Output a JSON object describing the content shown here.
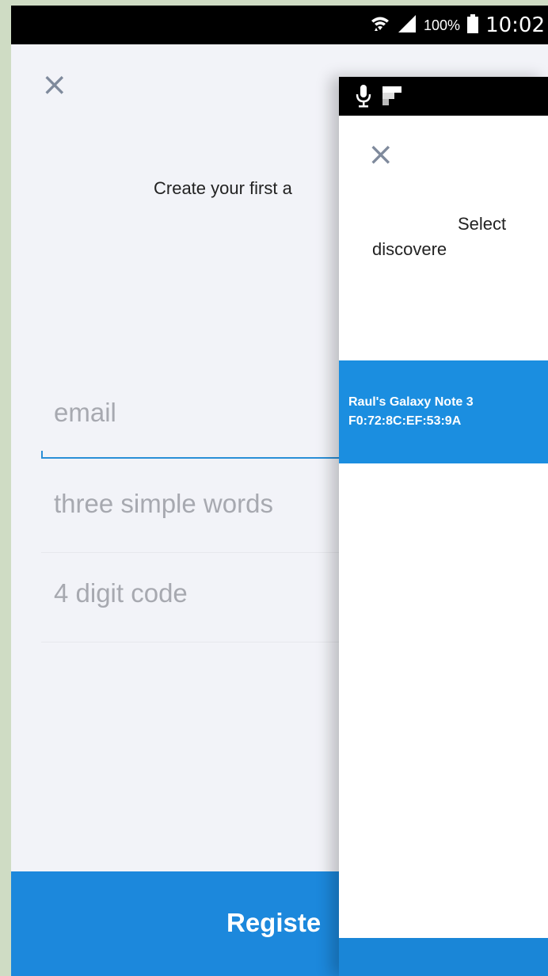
{
  "status_bar": {
    "battery_percent": "100%",
    "time": "10:02"
  },
  "registration": {
    "close_glyph": "×",
    "heading": "Create your first a",
    "fields": [
      {
        "placeholder": "email"
      },
      {
        "placeholder": "three simple words"
      },
      {
        "placeholder": "4 digit code"
      }
    ],
    "register_button_label": "Registe"
  },
  "device_picker": {
    "close_glyph": "×",
    "title_line1": "Select",
    "title_line2": "discovere",
    "devices": [
      {
        "name": "Raul's Galaxy Note 3",
        "mac": "F0:72:8C:EF:53:9A"
      }
    ]
  },
  "colors": {
    "accent_blue": "#1c88dc",
    "device_row_blue": "#1b8ee0",
    "screen_bg": "#f2f3f8",
    "placeholder_gray": "#a7a9b0",
    "border_green": "#cfdcc4"
  },
  "icons": [
    "wifi-icon",
    "signal-icon",
    "battery-icon",
    "mic-icon",
    "notification-app-icon",
    "close-icon"
  ]
}
